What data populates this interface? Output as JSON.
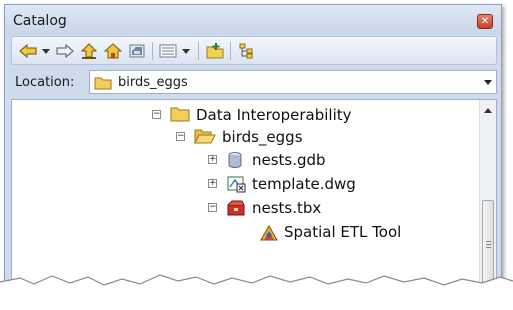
{
  "window": {
    "title": "Catalog",
    "close_icon": "close-icon"
  },
  "toolbar": {
    "buttons": [
      "back-icon",
      "forward-icon",
      "up-one-level-icon",
      "home-icon",
      "connect-folder-icon",
      "views-icon",
      "add-folder-icon",
      "toggle-contents-icon"
    ]
  },
  "location": {
    "label": "Location:",
    "value": "birds_eggs"
  },
  "tree": {
    "nodes": [
      {
        "label": "Data Interoperability",
        "icon": "folder-icon",
        "expanded": true
      },
      {
        "label": "birds_eggs",
        "icon": "open-folder-icon",
        "expanded": true
      },
      {
        "label": "nests.gdb",
        "icon": "geodatabase-icon",
        "expanded": false
      },
      {
        "label": "template.dwg",
        "icon": "cad-dataset-icon",
        "expanded": false
      },
      {
        "label": "nests.tbx",
        "icon": "toolbox-icon",
        "expanded": true
      },
      {
        "label": "Spatial ETL Tool",
        "icon": "spatial-etl-tool-icon"
      }
    ]
  },
  "colors": {
    "window_frame": "#cfdbec",
    "folder": "#f3cf5a",
    "close_button": "#c2412a"
  }
}
